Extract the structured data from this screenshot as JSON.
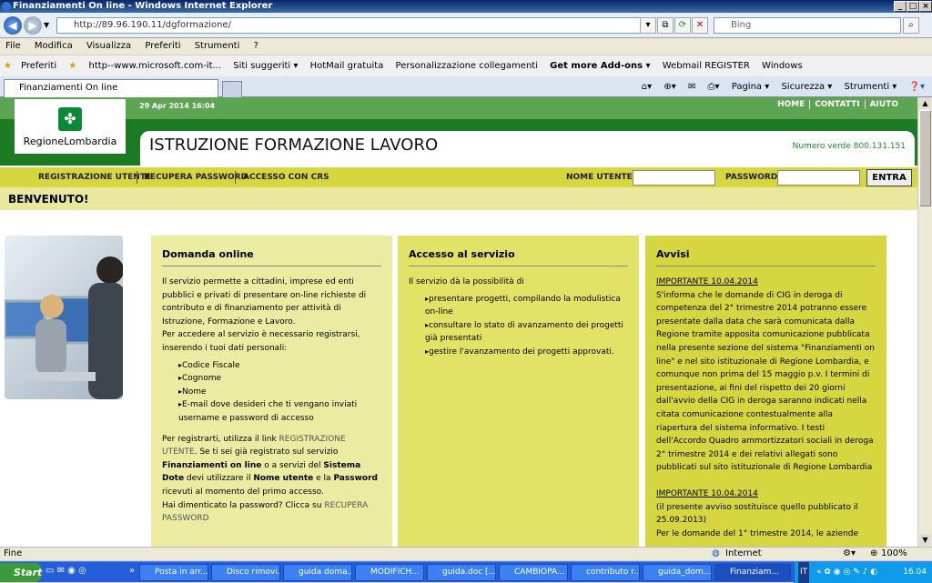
{
  "window": {
    "title": "Finanziamenti On line - Windows Internet Explorer"
  },
  "address": {
    "url": "http://89.96.190.11/dgformazione/",
    "search_placeholder": "Bing"
  },
  "menu": [
    "File",
    "Modifica",
    "Visualizza",
    "Preferiti",
    "Strumenti",
    "?"
  ],
  "favorites": {
    "label": "Preferiti",
    "items": [
      "http--www.microsoft.com-it...",
      "Siti suggeriti ▾",
      "HotMail gratuita",
      "Personalizzazione collegamenti",
      "Get more Add-ons ▾",
      "Webmail REGISTER",
      "Windows"
    ]
  },
  "tab": {
    "title": "Finanziamenti On line"
  },
  "commands": [
    "Pagina ▾",
    "Sicurezza ▾",
    "Strumenti ▾"
  ],
  "site": {
    "logo_text": "RegioneLombardia",
    "datetime": "29 Apr 2014 16:04",
    "toplinks": [
      "HOME",
      "CONTATTI",
      "AIUTO"
    ],
    "title": "ISTRUZIONE FORMAZIONE LAVORO",
    "numero_verde": "Numero verde 800.131.151",
    "nav": [
      "REGISTRAZIONE UTENTE",
      "RECUPERA PASSWORD",
      "ACCESSO CON CRS"
    ],
    "login": {
      "user_label": "NOME UTENTE",
      "pass_label": "PASSWORD",
      "button": "ENTRA"
    },
    "welcome": "BENVENUTO!"
  },
  "panels": {
    "domanda": {
      "heading": "Domanda online",
      "p1": "Il servizio permette a cittadini, imprese ed enti pubblici e privati di presentare on-line richieste di contributo e di finanziamento per attività di Istruzione, Formazione e Lavoro.",
      "p2": "Per accedere al servizio è necessario registrarsi, inserendo i tuoi dati personali:",
      "list": [
        "Codice Fiscale",
        "Cognome",
        "Nome",
        "E-mail dove desideri che ti vengano inviati username e password di accesso"
      ],
      "p3a": "Per registrarti, utilizza il link ",
      "p3link": "REGISTRAZIONE UTENTE",
      "p3b": "Se ti sei già registrato sul servizio ",
      "p3b_bold1": "Finanziamenti on line",
      "p3c": " o a servizi del ",
      "p3c_bold": "Sistema Dote",
      "p3d": " devi utilizzare il ",
      "p3d_bold1": "Nome utente",
      "p3e": " e la ",
      "p3e_bold": "Password",
      "p3f": " ricevuti al momento del primo accesso.",
      "p4": "Hai dimenticato la password? Clicca su ",
      "p4link": "RECUPERA PASSWORD"
    },
    "accesso": {
      "heading": "Accesso al servizio",
      "intro": "Il servizio dà la possibilità di",
      "list": [
        "presentare progetti, compilando la modulistica on-line",
        "consultare lo stato di avanzamento dei progetti già presentati",
        "gestire l'avanzamento dei progetti approvati."
      ]
    },
    "avvisi": {
      "heading": "Avvisi",
      "a1_title": "IMPORTANTE 10.04.2014",
      "a1_text": "S'informa che le domande di CIG in deroga di competenza del 2° trimestre 2014 potranno essere presentate dalla data che sarà comunicata dalla Regione tramite apposita comunicazione pubblicata nella presente sezione del sistema \"Finanziamenti on line\" e nel sito istituzionale di Regione Lombardia, e comunque non prima del 15 maggio p.v. I termini di presentazione, ai fini del rispetto dei 20 giorni dall'avvio della CIG in deroga saranno indicati nella citata comunicazione contestualmente alla riapertura del sistema informativo. I testi dell'Accordo Quadro ammortizzatori sociali in deroga 2° trimestre 2014 e dei relativi allegati sono pubblicati sul sito istituzionale di Regione Lombardia",
      "a2_title": "IMPORTANTE 10.04.2014",
      "a2_text": "(il presente avviso sostituisce quello pubblicato il 25.09.2013)",
      "a3_text": "Per le domande del 1° trimestre 2014, le aziende"
    }
  },
  "status": {
    "left": "Fine",
    "zone": "Internet",
    "zoom": "100%"
  },
  "taskbar": {
    "start": "Start",
    "items": [
      "Posta in arr...",
      "Disco rimovi...",
      "guida doma...",
      "MODIFICH...",
      "guida.doc [...",
      "CAMBIOPA...",
      "contributo r...",
      "guida_dom...",
      "Finanziam..."
    ],
    "time": "16.04",
    "lang": "IT"
  },
  "colors": {
    "green": "#1d7a25",
    "yellow": "#d6d640",
    "panel_bg": "#eceba2"
  }
}
